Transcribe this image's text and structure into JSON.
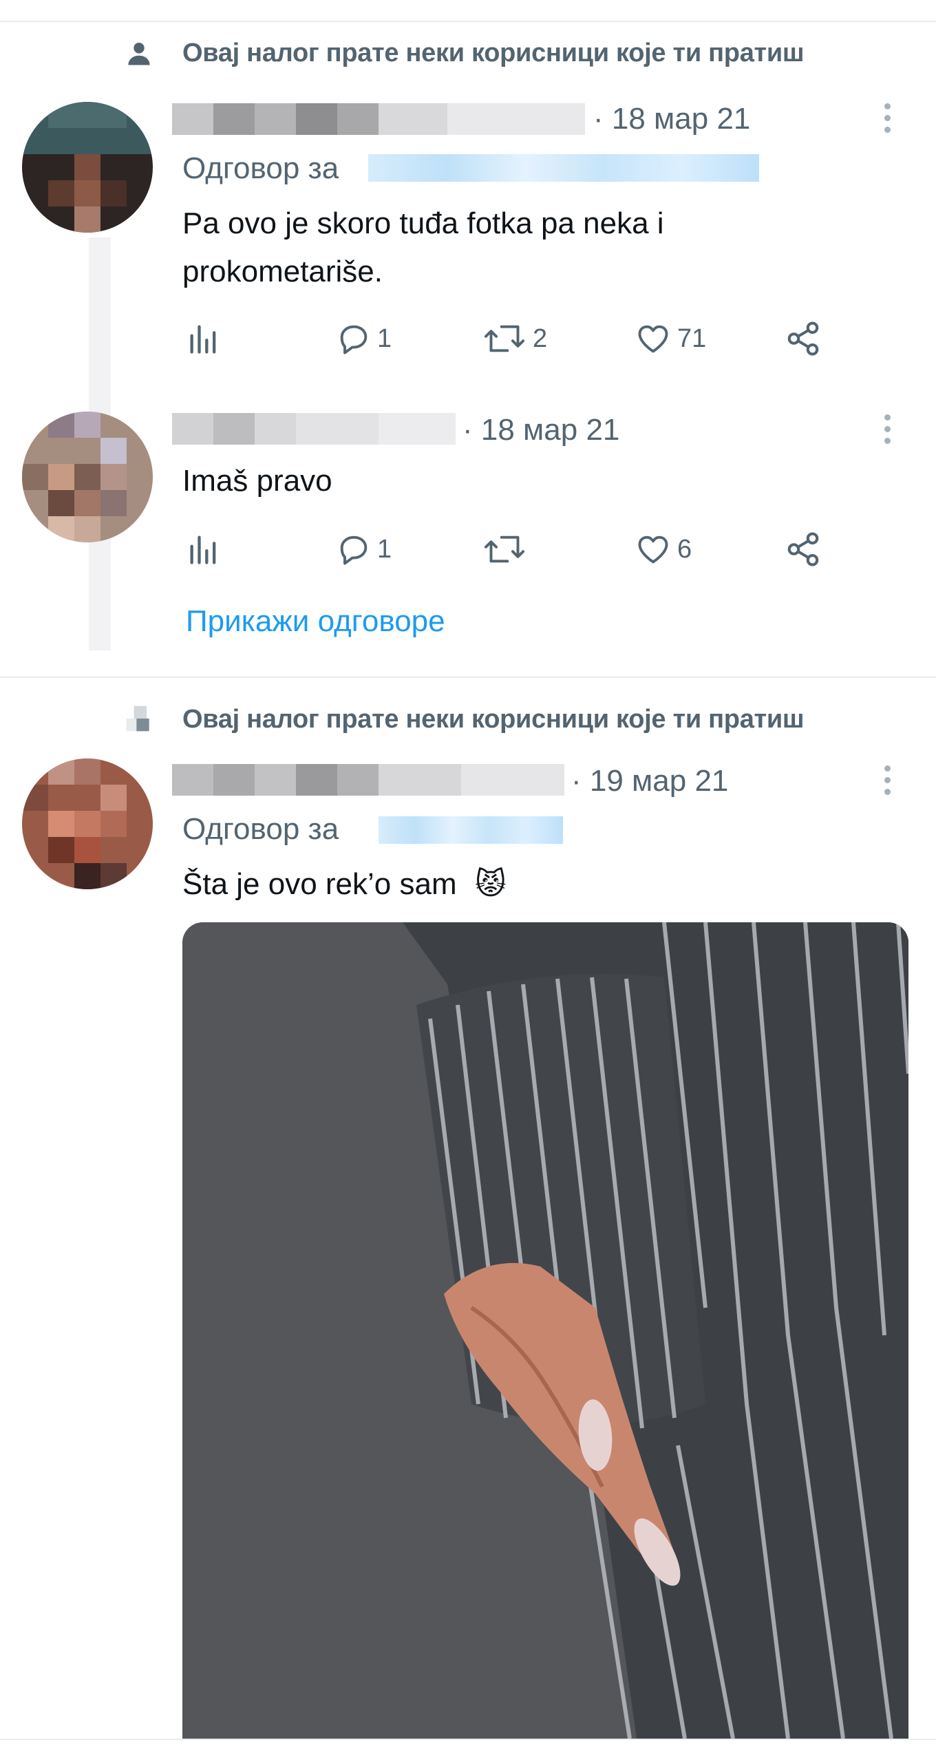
{
  "colors": {
    "text_primary": "#0f1419",
    "text_secondary": "#536471",
    "link": "#1d9bf0",
    "divider": "#e6ecf0",
    "media_background": "#545659",
    "sleeve": "#3d4146",
    "stripe": "#b9bcc1",
    "skin": "#c9866f",
    "nail": "#e7d2d2"
  },
  "icons": {
    "social_context": "person-icon",
    "more": "more-vertical-icon",
    "analytics": "analytics-icon",
    "reply": "reply-icon",
    "retweet": "retweet-icon",
    "like": "heart-icon",
    "share": "share-icon"
  },
  "tweets": [
    {
      "social_context": "Овај налог прате неки корисници које ти пратиш",
      "author_name": "",
      "date": "· 18 мар 21",
      "reply_to_label": "Одговор за",
      "text": "Pa ovo je skoro tuđa fotka pa neka i prokometariše.",
      "stats": {
        "analytics": "",
        "replies": "1",
        "retweets": "2",
        "likes": "71"
      }
    },
    {
      "author_name": "",
      "date": "· 18 мар 21",
      "text": "Imaš pravo",
      "stats": {
        "analytics": "",
        "replies": "1",
        "retweets": "",
        "likes": "6"
      },
      "show_replies": "Прикажи одговоре"
    },
    {
      "social_context": "Овај налог прате неки корисници које ти пратиш",
      "author_name": "",
      "date": "· 19 мар 21",
      "reply_to_label": "Одговор за",
      "text": "Šta je ovo rek’o sam",
      "emoji": "😾",
      "media": {
        "type": "photo"
      }
    }
  ]
}
